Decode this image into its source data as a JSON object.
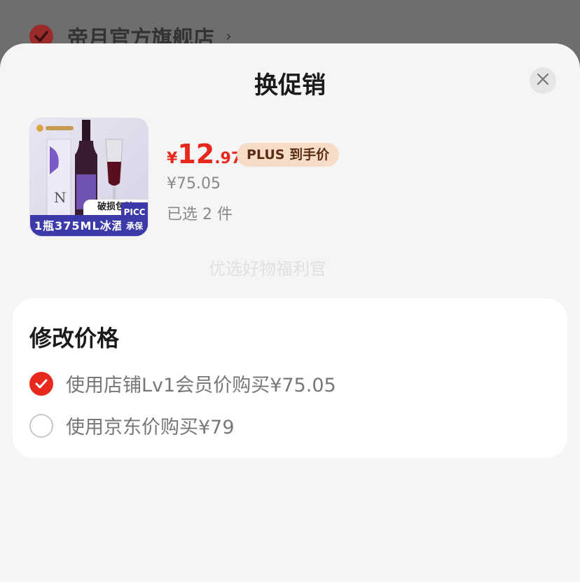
{
  "background": {
    "shop_name": "帝月官方旗舰店",
    "chevron": "›"
  },
  "sheet": {
    "title": "换促销",
    "close_icon": "close-icon"
  },
  "product": {
    "image_band_text": "1瓶375ML冰酒",
    "image_tag": "破损包赔",
    "image_tag2": "PICC 承保",
    "currency_symbol": "¥",
    "price_int": "12",
    "price_dec": ".97",
    "plus_badge": "PLUS 到手价",
    "original_price": "¥75.05",
    "selected_count": "已选 2 件"
  },
  "watermark": "优选好物福利官",
  "price_options": {
    "title": "修改价格",
    "options": [
      {
        "label": "使用店铺Lv1会员价购买¥75.05",
        "selected": true
      },
      {
        "label": "使用京东价购买¥79",
        "selected": false
      }
    ]
  },
  "colors": {
    "accent_red": "#e8281d",
    "plus_badge_bg": "#f7dcc8",
    "sheet_bg": "#f5f5f5"
  }
}
